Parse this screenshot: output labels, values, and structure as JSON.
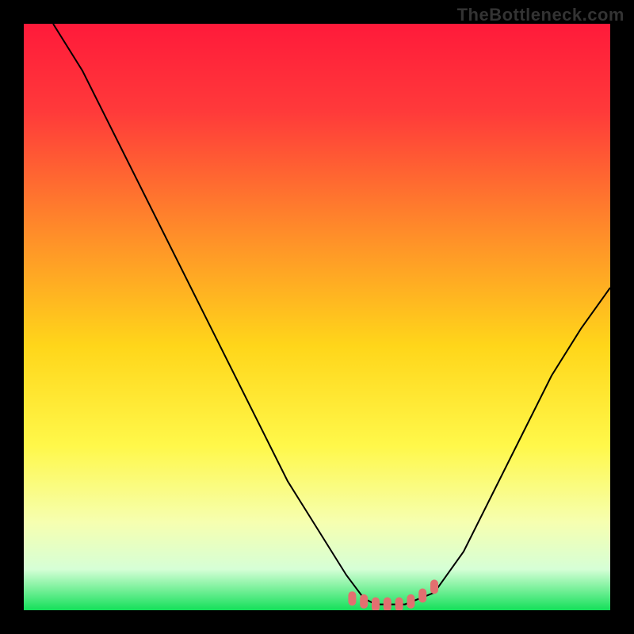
{
  "watermark": "TheBottleneck.com",
  "colors": {
    "background": "#000000",
    "curve_stroke": "#000000",
    "marker_fill": "#e27070",
    "gradient_stops": [
      {
        "offset": 0.0,
        "color": "#ff1a3a"
      },
      {
        "offset": 0.15,
        "color": "#ff3a3a"
      },
      {
        "offset": 0.35,
        "color": "#ff8a2a"
      },
      {
        "offset": 0.55,
        "color": "#ffd61a"
      },
      {
        "offset": 0.72,
        "color": "#fff84a"
      },
      {
        "offset": 0.85,
        "color": "#f6ffb0"
      },
      {
        "offset": 0.93,
        "color": "#d6ffd6"
      },
      {
        "offset": 1.0,
        "color": "#14e05a"
      }
    ]
  },
  "chart_data": {
    "type": "line",
    "title": "",
    "xlabel": "",
    "ylabel": "",
    "xlim": [
      0,
      100
    ],
    "ylim": [
      0,
      100
    ],
    "grid": false,
    "series": [
      {
        "name": "bottleneck-curve",
        "x": [
          5,
          10,
          15,
          20,
          25,
          30,
          35,
          40,
          45,
          50,
          55,
          58,
          60,
          62,
          65,
          70,
          75,
          80,
          85,
          90,
          95,
          100
        ],
        "values": [
          100,
          92,
          82,
          72,
          62,
          52,
          42,
          32,
          22,
          14,
          6,
          2,
          1,
          1,
          1,
          3,
          10,
          20,
          30,
          40,
          48,
          55
        ]
      }
    ],
    "markers": {
      "name": "highlighted-region",
      "x": [
        56,
        58,
        60,
        62,
        64,
        66,
        68,
        70
      ],
      "values": [
        2,
        1.5,
        1,
        1,
        1,
        1.5,
        2.5,
        4
      ]
    }
  }
}
